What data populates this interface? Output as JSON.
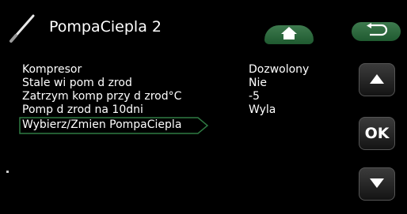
{
  "header": {
    "title": "PompaCiepla 2",
    "title_icon": "thermometer-probe-icon",
    "home_icon": "home-icon",
    "back_icon": "back-arrow-icon"
  },
  "settings": {
    "rows": [
      {
        "label": "Kompresor",
        "value": "Dozwolony"
      },
      {
        "label": "Stale wi pom d zrod",
        "value": "Nie"
      },
      {
        "label": "Zatrzym komp przy d zrod°C",
        "value": "-5"
      },
      {
        "label": "Pomp d zrod na 10dni",
        "value": "Wyla"
      }
    ],
    "selected_row": {
      "label": "Wybierz/Zmien PompaCiepla"
    }
  },
  "side_buttons": {
    "up_icon": "arrow-up-icon",
    "ok_label": "OK",
    "down_icon": "arrow-down-icon"
  },
  "colors": {
    "background": "#000000",
    "button_green": "#2f6b3f",
    "selection_outline": "#2f7a43",
    "text": "#ffffff"
  }
}
